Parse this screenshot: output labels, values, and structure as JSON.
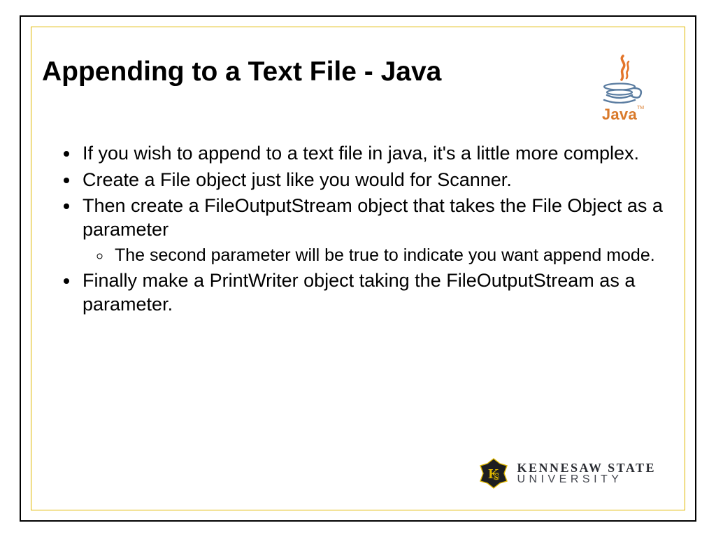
{
  "title": "Appending to a Text File - Java",
  "java_logo": {
    "label": "Java"
  },
  "bullets": [
    {
      "text": "If you wish to append to a text file in java, it's a little more complex."
    },
    {
      "text": "Create a File object just like you would for Scanner."
    },
    {
      "text": "Then create a FileOutputStream object that takes the File Object as a parameter",
      "sub": [
        "The second parameter will be true to indicate you want append mode."
      ]
    },
    {
      "text": "Finally make a PrintWriter object taking the FileOutputStream as a parameter."
    }
  ],
  "ksu": {
    "line1": "KENNESAW STATE",
    "line2": "UNIVERSITY"
  }
}
